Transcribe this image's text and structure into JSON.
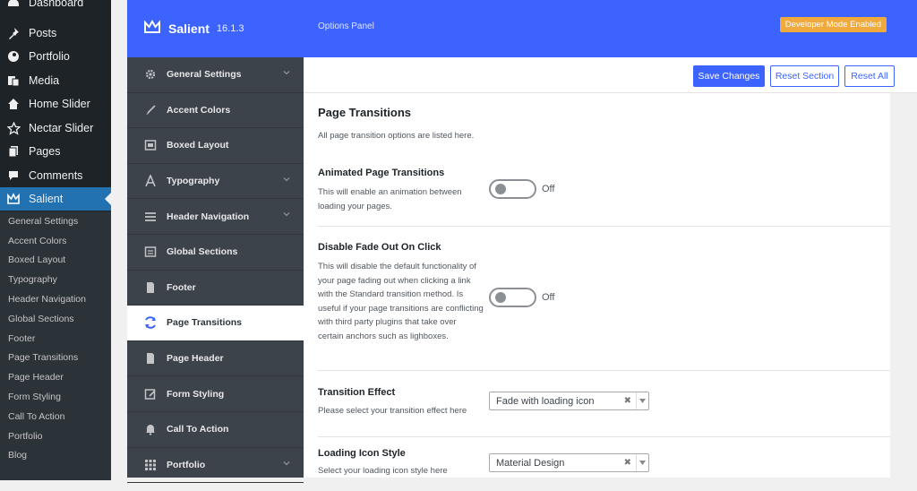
{
  "wp_menu": {
    "items": [
      {
        "label": "Dashboard",
        "icon": "dashboard-icon"
      },
      {
        "label": "Posts",
        "icon": "pin-icon"
      },
      {
        "label": "Portfolio",
        "icon": "portfolio-icon"
      },
      {
        "label": "Media",
        "icon": "media-icon"
      },
      {
        "label": "Home Slider",
        "icon": "home-icon"
      },
      {
        "label": "Nectar Slider",
        "icon": "star-icon"
      },
      {
        "label": "Pages",
        "icon": "pages-icon"
      },
      {
        "label": "Comments",
        "icon": "comment-icon"
      },
      {
        "label": "Salient",
        "icon": "crown-icon"
      }
    ],
    "submenu": [
      "General Settings",
      "Accent Colors",
      "Boxed Layout",
      "Typography",
      "Header Navigation",
      "Global Sections",
      "Footer",
      "Page Transitions",
      "Page Header",
      "Form Styling",
      "Call To Action",
      "Portfolio",
      "Blog"
    ]
  },
  "brand": {
    "name": "Salient",
    "version": "16.1.3"
  },
  "header": {
    "subtitle": "Options Panel",
    "badge": "Developer Mode Enabled"
  },
  "nav": [
    {
      "label": "General Settings",
      "icon": "gear-icon",
      "chevron": true
    },
    {
      "label": "Accent Colors",
      "icon": "brush-icon",
      "chevron": false
    },
    {
      "label": "Boxed Layout",
      "icon": "boxed-layout-icon",
      "chevron": false
    },
    {
      "label": "Typography",
      "icon": "typography-icon",
      "chevron": true
    },
    {
      "label": "Header Navigation",
      "icon": "menu-icon",
      "chevron": true
    },
    {
      "label": "Global Sections",
      "icon": "global-sections-icon",
      "chevron": false
    },
    {
      "label": "Footer",
      "icon": "footer-icon",
      "chevron": false
    },
    {
      "label": "Page Transitions",
      "icon": "refresh-icon",
      "chevron": false,
      "active": true
    },
    {
      "label": "Page Header",
      "icon": "page-header-icon",
      "chevron": false
    },
    {
      "label": "Form Styling",
      "icon": "form-edit-icon",
      "chevron": false
    },
    {
      "label": "Call To Action",
      "icon": "bell-icon",
      "chevron": false
    },
    {
      "label": "Portfolio",
      "icon": "grid-icon",
      "chevron": true
    }
  ],
  "actions": {
    "save": "Save Changes",
    "reset_section": "Reset Section",
    "reset_all": "Reset All"
  },
  "section": {
    "title": "Page Transitions",
    "description": "All page transition options are listed here."
  },
  "options": {
    "animated": {
      "title": "Animated Page Transitions",
      "desc": "This will enable an animation between loading your pages.",
      "state": "Off"
    },
    "fadeout": {
      "title": "Disable Fade Out On Click",
      "desc": "This will disable the default functionality of your page fading out when clicking a link with the Standard transition method. Is useful if your page transitions are conflicting with third party plugins that take over certain anchors such as lighboxes.",
      "state": "Off"
    },
    "effect": {
      "title": "Transition Effect",
      "desc": "Please select your transition effect here",
      "value": "Fade with loading icon"
    },
    "icon_style": {
      "title": "Loading Icon Style",
      "desc": "Select your loading icon style here",
      "value": "Material Design"
    }
  },
  "colors": {
    "accent": "#3d63ff",
    "badge": "#f0a93c",
    "sidebar": "#1d2327",
    "panel_nav": "#3c434a"
  }
}
